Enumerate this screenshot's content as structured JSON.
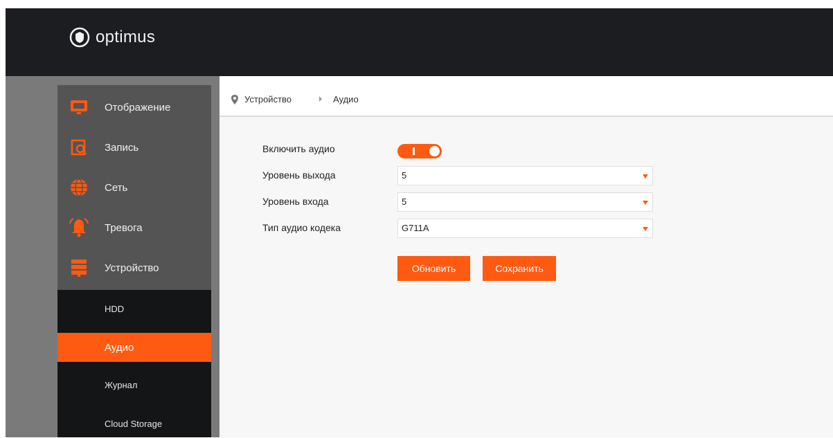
{
  "brand": {
    "name": "optimus"
  },
  "sidebar": {
    "items": [
      {
        "label": "Отображение",
        "icon": "monitor-icon"
      },
      {
        "label": "Запись",
        "icon": "record-search-icon"
      },
      {
        "label": "Сеть",
        "icon": "globe-icon"
      },
      {
        "label": "Тревога",
        "icon": "alarm-bell-icon"
      },
      {
        "label": "Устройство",
        "icon": "device-stack-icon"
      }
    ],
    "submenu": [
      {
        "label": "HDD"
      },
      {
        "label": "Аудио",
        "active": true
      },
      {
        "label": "Журнал"
      },
      {
        "label": "Cloud Storage"
      }
    ]
  },
  "breadcrumb": {
    "parent": "Устройство",
    "current": "Аудио"
  },
  "form": {
    "enable_label": "Включить аудио",
    "enable_value": true,
    "output_label": "Уровень выхода",
    "output_value": "5",
    "input_label": "Уровень входа",
    "input_value": "5",
    "codec_label": "Тип аудио кодека",
    "codec_value": "G711A"
  },
  "buttons": {
    "refresh": "Обновить",
    "save": "Сохранить"
  },
  "colors": {
    "accent": "#ff5a12",
    "header": "#1c1d20",
    "sidebar": "#545454",
    "submenu": "#141516"
  }
}
